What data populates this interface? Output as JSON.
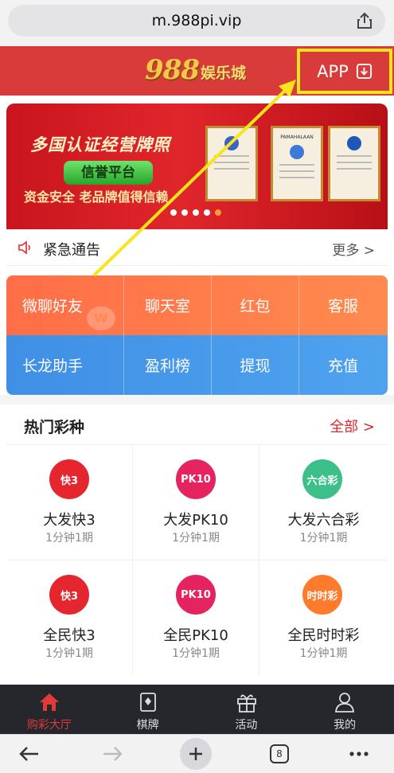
{
  "browser": {
    "url": "m.988pi.vip",
    "tab_count": "8"
  },
  "header": {
    "logo_number": "988",
    "logo_text": "娱乐城",
    "app_button": "APP"
  },
  "banner": {
    "title": "多国认证经营牌照",
    "pill": "信誉平台",
    "subtitle": "资金安全 老品牌值得信赖",
    "certificates": [
      "PAMAHALAAN"
    ],
    "slide_count": 5,
    "active_slide": 5
  },
  "notice": {
    "label": "紧急通告",
    "more": "更多 >"
  },
  "menu": {
    "row1": [
      "微聊好友",
      "聊天室",
      "红包",
      "客服"
    ],
    "row2": [
      "长龙助手",
      "盈利榜",
      "提现",
      "充值"
    ],
    "colors": {
      "row1": "#ff7a4a",
      "row2": "#4597ea"
    }
  },
  "hot": {
    "title": "热门彩种",
    "all": "全部 >",
    "items": [
      {
        "name": "大发快3",
        "sub": "1分钟1期",
        "icon": "快3",
        "color": "#e5262e"
      },
      {
        "name": "大发PK10",
        "sub": "1分钟1期",
        "icon": "PK10",
        "color": "#e5245f"
      },
      {
        "name": "大发六合彩",
        "sub": "1分钟1期",
        "icon": "六合彩",
        "color": "#3dbf8a"
      },
      {
        "name": "全民快3",
        "sub": "1分钟1期",
        "icon": "快3",
        "color": "#e5262e"
      },
      {
        "name": "全民PK10",
        "sub": "1分钟1期",
        "icon": "PK10",
        "color": "#e5245f"
      },
      {
        "name": "全民时时彩",
        "sub": "1分钟1期",
        "icon": "时时彩",
        "color": "#ff7a2a"
      }
    ]
  },
  "tabbar": [
    {
      "label": "购彩大厅",
      "icon": "home-icon",
      "active": true
    },
    {
      "label": "棋牌",
      "icon": "cards-icon",
      "active": false
    },
    {
      "label": "活动",
      "icon": "gift-icon",
      "active": false
    },
    {
      "label": "我的",
      "icon": "user-icon",
      "active": false
    }
  ],
  "colors": {
    "brand_red": "#d93b3b",
    "highlight": "#f9e51c",
    "active_tab": "#e23a3a"
  }
}
